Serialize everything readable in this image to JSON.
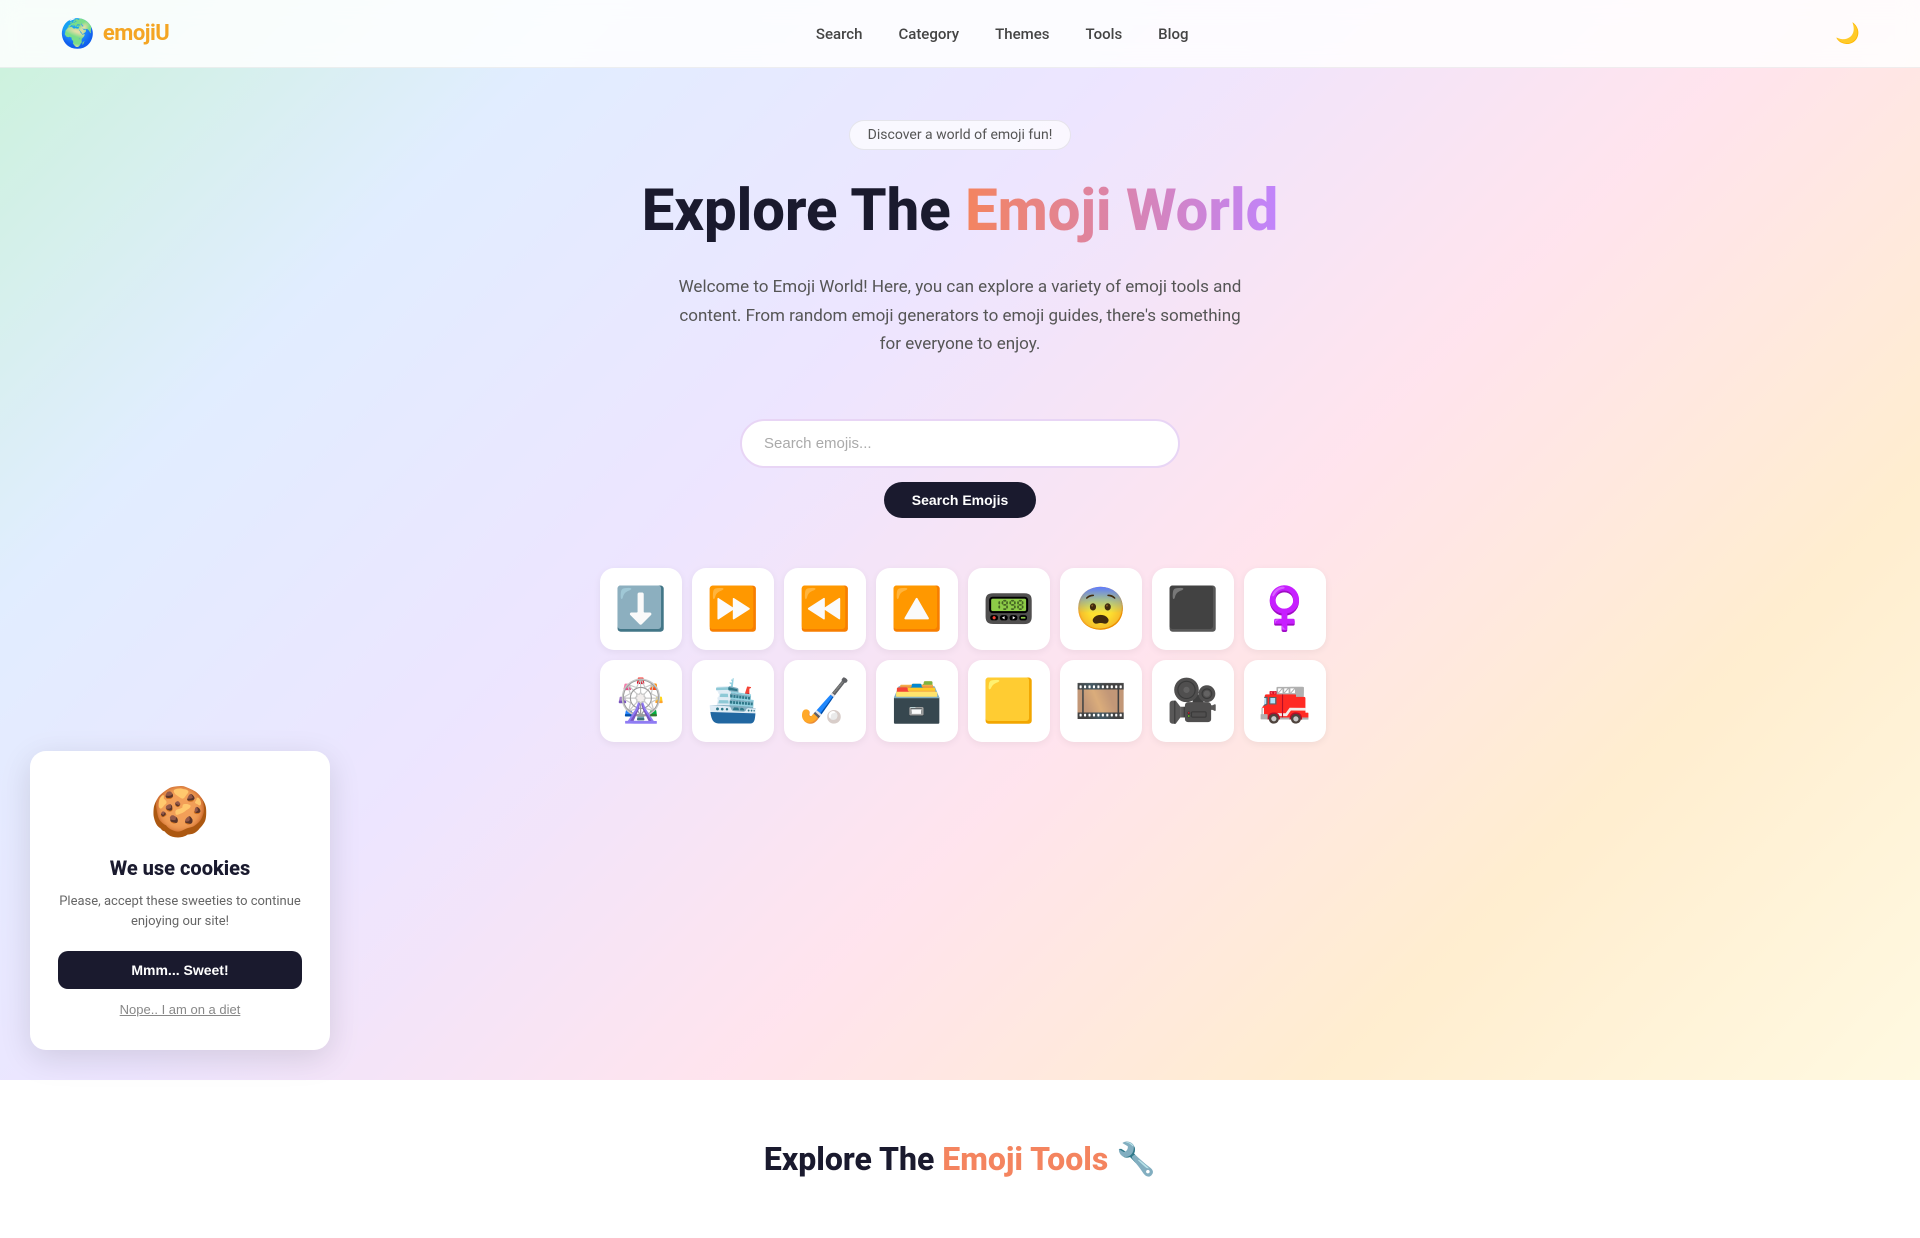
{
  "nav": {
    "logo_emoji": "🌍",
    "logo_text": "emoji",
    "logo_text_colored": "U",
    "links": [
      {
        "label": "Search",
        "id": "search"
      },
      {
        "label": "Category",
        "id": "category"
      },
      {
        "label": "Themes",
        "id": "themes"
      },
      {
        "label": "Tools",
        "id": "tools"
      },
      {
        "label": "Blog",
        "id": "blog"
      }
    ],
    "theme_icon": "🌙"
  },
  "hero": {
    "badge": "Discover a world of emoji fun!",
    "title_start": "Explore The ",
    "title_gradient": "Emoji World",
    "description": "Welcome to Emoji World! Here, you can explore a variety of emoji tools and content. From random emoji generators to emoji guides, there's something for everyone to enjoy.",
    "search_placeholder": "Search emojis...",
    "search_button_label": "Search Emojis"
  },
  "emoji_rows": [
    [
      "⬇️",
      "⏩",
      "⏪",
      "🔼",
      "📟",
      "😨",
      "🔲",
      "♀️"
    ],
    [
      "🎡",
      "🛳️",
      "🏑",
      "🗃️",
      "🟨",
      "🎞️",
      "🎥",
      "🚒"
    ]
  ],
  "tools_section": {
    "title_start": "Explore The ",
    "title_colored": "Emoji Tools",
    "title_emoji": "🔧"
  },
  "cookie": {
    "emoji": "🍪",
    "title": "We use cookies",
    "description": "Please, accept these sweeties to continue enjoying our site!",
    "accept_label": "Mmm... Sweet!",
    "decline_label": "Nope.. I am on a diet"
  }
}
